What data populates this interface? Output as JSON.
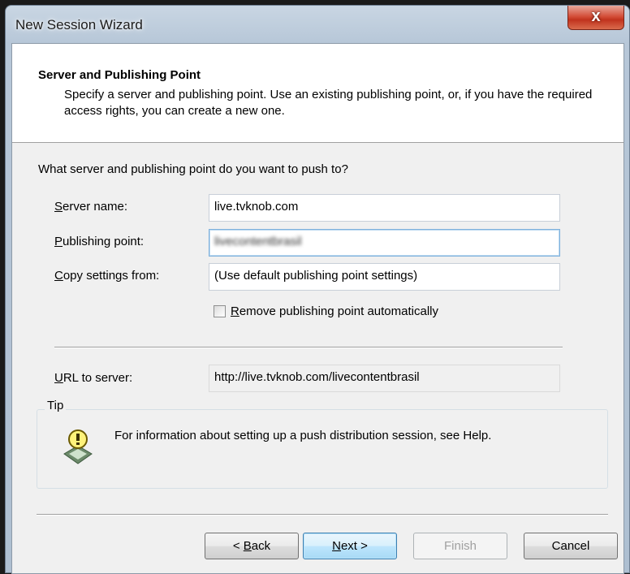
{
  "window": {
    "title": "New Session Wizard",
    "close_glyph": "x"
  },
  "header": {
    "title": "Server and Publishing Point",
    "description": "Specify a server and publishing point. Use an existing publishing point, or, if you have the required access rights, you can create a new one."
  },
  "form": {
    "question": "What server and publishing point do you want to push to?",
    "server_name": {
      "mnemonic": "S",
      "label_rest": "erver name:",
      "value": "live.tvknob.com"
    },
    "publishing_point": {
      "mnemonic": "P",
      "label_rest": "ublishing point:",
      "value": "livecontentbrasil"
    },
    "copy_settings": {
      "mnemonic": "C",
      "label_rest": "opy settings from:",
      "value": "(Use default publishing point settings)"
    },
    "remove_checkbox": {
      "mnemonic": "R",
      "label_rest": "emove publishing point automatically",
      "checked": false
    },
    "url_to_server": {
      "mnemonic": "U",
      "label_rest": "RL to server:",
      "value": "http://live.tvknob.com/livecontentbrasil"
    }
  },
  "tip": {
    "label": "Tip",
    "icon": "tip-lightbulb-icon",
    "text": "For information about setting up a push distribution session, see Help."
  },
  "buttons": {
    "back": {
      "prefix": "< ",
      "mnemonic": "B",
      "rest": "ack"
    },
    "next": {
      "mnemonic": "N",
      "rest": "ext >"
    },
    "finish": "Finish",
    "cancel": "Cancel"
  }
}
